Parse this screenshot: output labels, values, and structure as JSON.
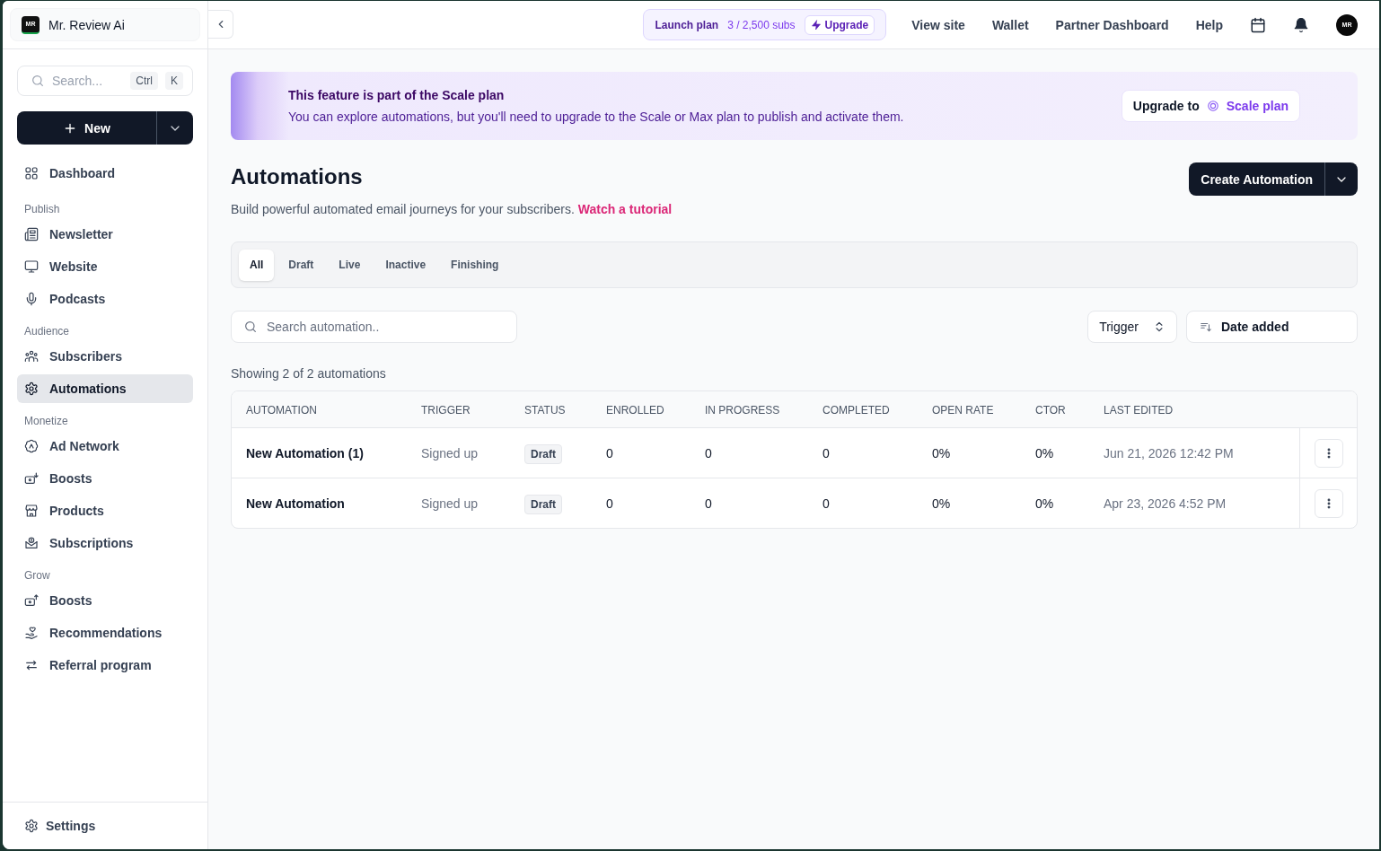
{
  "sidebar": {
    "workspace": {
      "logo_text": "MR",
      "name": "Mr. Review Ai"
    },
    "search": {
      "placeholder": "Search...",
      "shortcut": [
        "Ctrl",
        "K"
      ]
    },
    "new_button": "New",
    "sections": [
      {
        "items": [
          {
            "label": "Dashboard",
            "selected": false
          }
        ]
      },
      {
        "title": "Publish",
        "items": [
          {
            "label": "Newsletter",
            "selected": false
          },
          {
            "label": "Website",
            "selected": false
          },
          {
            "label": "Podcasts",
            "selected": false
          }
        ]
      },
      {
        "title": "Audience",
        "items": [
          {
            "label": "Subscribers",
            "selected": false
          },
          {
            "label": "Automations",
            "selected": true
          }
        ]
      },
      {
        "title": "Monetize",
        "items": [
          {
            "label": "Ad Network",
            "selected": false
          },
          {
            "label": "Boosts",
            "selected": false
          },
          {
            "label": "Products",
            "selected": false
          },
          {
            "label": "Subscriptions",
            "selected": false
          }
        ]
      },
      {
        "title": "Grow",
        "items": [
          {
            "label": "Boosts",
            "selected": false
          },
          {
            "label": "Recommendations",
            "selected": false
          },
          {
            "label": "Referral program",
            "selected": false
          }
        ]
      }
    ],
    "settings": "Settings"
  },
  "top_bar": {
    "plan": {
      "name": "Launch plan",
      "usage": "3 / 2,500 subs",
      "upgrade": "Upgrade"
    },
    "links": [
      "View site",
      "Wallet",
      "Partner Dashboard",
      "Help"
    ],
    "avatar_text": "MR"
  },
  "banner": {
    "title": "This feature is part of the Scale plan",
    "message": "You can explore automations, but you'll need to upgrade to the Scale or Max plan to publish and activate them.",
    "button": {
      "label": "Upgrade to",
      "plan": "Scale plan"
    }
  },
  "page": {
    "title": "Automations",
    "description": "Build powerful automated email journeys for your subscribers.",
    "link": "Watch a tutorial",
    "create_button": "Create Automation"
  },
  "tabs": [
    {
      "label": "All",
      "selected": true
    },
    {
      "label": "Draft",
      "selected": false
    },
    {
      "label": "Live",
      "selected": false
    },
    {
      "label": "Inactive",
      "selected": false
    },
    {
      "label": "Finishing",
      "selected": false
    }
  ],
  "search": {
    "placeholder": "Search automation.."
  },
  "filters": {
    "trigger": "Trigger",
    "sort": "Date added"
  },
  "result_count": "Showing 2 of 2 automations",
  "table": {
    "columns": [
      "AUTOMATION",
      "TRIGGER",
      "STATUS",
      "ENROLLED",
      "IN PROGRESS",
      "COMPLETED",
      "OPEN RATE",
      "CTOR",
      "LAST EDITED"
    ],
    "rows": [
      {
        "name": "New Automation (1)",
        "trigger": "Signed up",
        "status": "Draft",
        "enrolled": "0",
        "in_progress": "0",
        "completed": "0",
        "open_rate": "0%",
        "ctor": "0%",
        "last_edited": "Jun 21, 2026 12:42 PM"
      },
      {
        "name": "New Automation",
        "trigger": "Signed up",
        "status": "Draft",
        "enrolled": "0",
        "in_progress": "0",
        "completed": "0",
        "open_rate": "0%",
        "ctor": "0%",
        "last_edited": "Apr 23, 2026 4:52 PM"
      }
    ]
  }
}
